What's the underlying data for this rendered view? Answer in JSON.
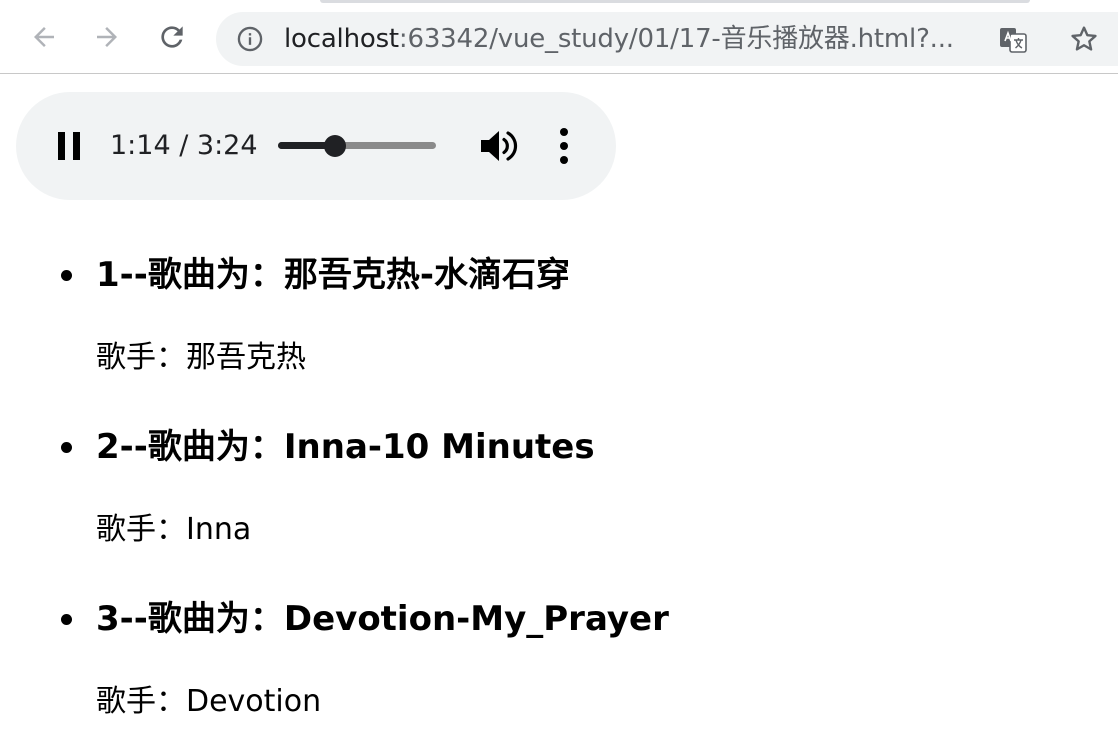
{
  "browser": {
    "url_host": "localhost",
    "url_path": ":63342/vue_study/01/17-音乐播放器.html?...",
    "icons": {
      "back": "arrow-left-icon",
      "forward": "arrow-right-icon",
      "reload": "reload-icon",
      "info": "info-icon",
      "translate": "translate-icon",
      "bookmark": "star-icon"
    }
  },
  "player": {
    "state": "playing",
    "time_text": "1:14 / 3:24",
    "progress_fraction": 0.36,
    "icons": {
      "play_pause": "pause-icon",
      "volume": "volume-icon",
      "menu": "more-vertical-icon"
    }
  },
  "songs": [
    {
      "title": "1--歌曲为：那吾克热-水滴石穿",
      "singer": "歌手：那吾克热"
    },
    {
      "title": "2--歌曲为：Inna-10 Minutes",
      "singer": "歌手：Inna"
    },
    {
      "title": "3--歌曲为：Devotion-My_Prayer",
      "singer": "歌手：Devotion"
    }
  ]
}
